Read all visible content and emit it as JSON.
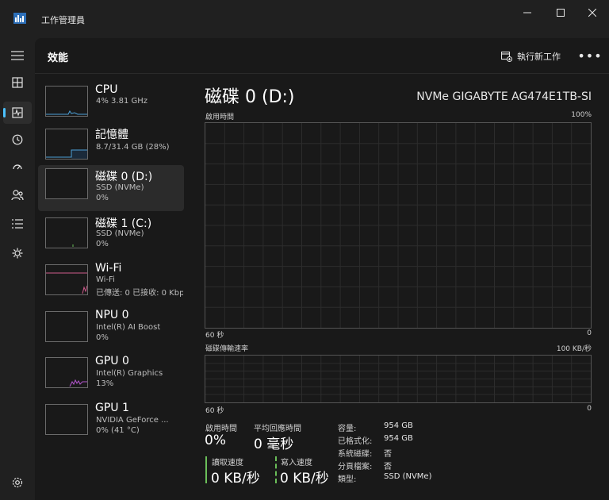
{
  "titlebar": {
    "title": "工作管理員",
    "minimize_icon": "minimize-icon",
    "maximize_icon": "maximize-icon",
    "close_icon": "close-icon"
  },
  "header": {
    "page_title": "效能",
    "run_task_label": "執行新工作",
    "more_icon": "more-icon"
  },
  "rail": {
    "items": [
      "hamburger-menu-icon",
      "processes-icon",
      "performance-icon",
      "app-history-icon",
      "startup-apps-icon",
      "users-icon",
      "details-icon",
      "services-icon"
    ],
    "settings": "settings-icon"
  },
  "sidebar": {
    "items": [
      {
        "name": "CPU",
        "sub1": "4%  3.81 GHz",
        "sub2": ""
      },
      {
        "name": "記憶體",
        "sub1": "8.7/31.4 GB (28%)",
        "sub2": ""
      },
      {
        "name": "磁碟 0 (D:)",
        "sub1": "SSD (NVMe)",
        "sub2": "0%"
      },
      {
        "name": "磁碟 1 (C:)",
        "sub1": "SSD (NVMe)",
        "sub2": "0%"
      },
      {
        "name": "Wi-Fi",
        "sub1": "Wi-Fi",
        "sub2": "已傳送: 0 已接收: 0 Kbps"
      },
      {
        "name": "NPU 0",
        "sub1": "Intel(R) AI Boost",
        "sub2": "0%"
      },
      {
        "name": "GPU 0",
        "sub1": "Intel(R) Graphics",
        "sub2": "13%"
      },
      {
        "name": "GPU 1",
        "sub1": "NVIDIA GeForce ...",
        "sub2": "0% (41 °C)"
      }
    ]
  },
  "detail": {
    "title": "磁碟 0 (D:)",
    "model": "NVMe GIGABYTE AG474E1TB-SI",
    "graph1": {
      "label": "啟用時間",
      "max": "100%",
      "time_left": "60 秒",
      "time_right": "0"
    },
    "graph2": {
      "label": "磁碟傳輸速率",
      "max": "100 KB/秒",
      "time_left": "60 秒",
      "time_right": "0"
    },
    "active_time": {
      "label": "啟用時間",
      "value": "0%"
    },
    "avg_response": {
      "label": "平均回應時間",
      "value": "0 毫秒"
    },
    "read_speed": {
      "label": "讀取速度",
      "value": "0 KB/秒"
    },
    "write_speed": {
      "label": "寫入速度",
      "value": "0 KB/秒"
    },
    "props": [
      {
        "key": "容量:",
        "val": "954 GB"
      },
      {
        "key": "已格式化:",
        "val": "954 GB"
      },
      {
        "key": "系統磁碟:",
        "val": "否"
      },
      {
        "key": "分頁檔案:",
        "val": "否"
      },
      {
        "key": "類型:",
        "val": "SSD (NVMe)"
      }
    ]
  },
  "colors": {
    "accent": "#4cc2ff",
    "disk_accent": "#6bbf59",
    "cpu_line": "#4ca0d8",
    "wifi_line": "#d05a8c",
    "gpu_line": "#b556d0"
  }
}
